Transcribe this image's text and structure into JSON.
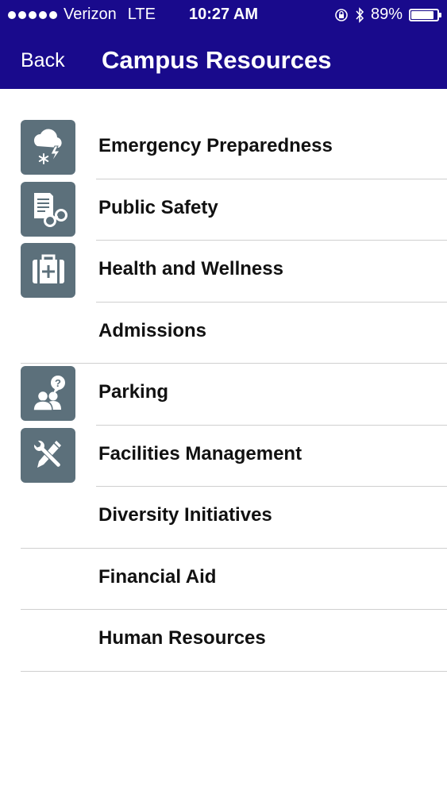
{
  "status_bar": {
    "carrier": "Verizon",
    "network": "LTE",
    "time": "10:27 AM",
    "battery": "89%",
    "battery_level": 0.89
  },
  "nav": {
    "back_label": "Back",
    "title": "Campus Resources"
  },
  "theme": {
    "nav_bar_color": "#190a8c",
    "icon_tile_color": "#5c707b"
  },
  "items": [
    {
      "label": "Emergency Preparedness",
      "icon": "weather-storm-icon"
    },
    {
      "label": "Public Safety",
      "icon": "report-handcuffs-icon"
    },
    {
      "label": "Health and Wellness",
      "icon": "first-aid-kit-icon"
    },
    {
      "label": "Admissions",
      "icon": ""
    },
    {
      "label": "Parking",
      "icon": "people-question-icon"
    },
    {
      "label": "Facilities Management",
      "icon": "tools-icon"
    },
    {
      "label": "Diversity Initiatives",
      "icon": ""
    },
    {
      "label": "Financial Aid",
      "icon": ""
    },
    {
      "label": "Human Resources",
      "icon": ""
    }
  ]
}
